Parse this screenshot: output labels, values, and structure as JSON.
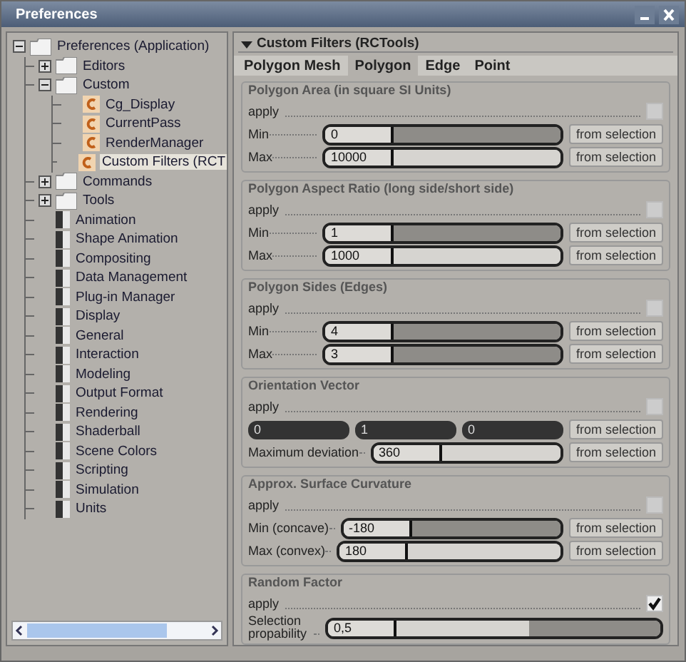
{
  "window": {
    "title": "Preferences"
  },
  "tree": [
    {
      "label": "Preferences (Application)",
      "kind": "folder",
      "expanded": true,
      "selected": false,
      "children": [
        {
          "label": "Editors",
          "kind": "folder",
          "expanded": false,
          "selected": false
        },
        {
          "label": "Custom",
          "kind": "folder",
          "expanded": true,
          "selected": false,
          "children": [
            {
              "label": "Cg_Display",
              "kind": "custom",
              "selected": false
            },
            {
              "label": "CurrentPass",
              "kind": "custom",
              "selected": false
            },
            {
              "label": "RenderManager",
              "kind": "custom",
              "selected": false
            },
            {
              "label": "Custom Filters (RCT",
              "kind": "custom",
              "selected": true
            }
          ]
        },
        {
          "label": "Commands",
          "kind": "folder",
          "expanded": false,
          "selected": false
        },
        {
          "label": "Tools",
          "kind": "folder",
          "expanded": false,
          "selected": false
        },
        {
          "label": "Animation",
          "kind": "pref",
          "selected": false
        },
        {
          "label": "Shape Animation",
          "kind": "pref",
          "selected": false
        },
        {
          "label": "Compositing",
          "kind": "pref",
          "selected": false
        },
        {
          "label": "Data Management",
          "kind": "pref",
          "selected": false
        },
        {
          "label": "Plug-in Manager",
          "kind": "pref",
          "selected": false
        },
        {
          "label": "Display",
          "kind": "pref",
          "selected": false
        },
        {
          "label": "General",
          "kind": "pref",
          "selected": false
        },
        {
          "label": "Interaction",
          "kind": "pref",
          "selected": false
        },
        {
          "label": "Modeling",
          "kind": "pref",
          "selected": false
        },
        {
          "label": "Output Format",
          "kind": "pref",
          "selected": false
        },
        {
          "label": "Rendering",
          "kind": "pref",
          "selected": false
        },
        {
          "label": "Shaderball",
          "kind": "pref",
          "selected": false
        },
        {
          "label": "Scene Colors",
          "kind": "pref",
          "selected": false
        },
        {
          "label": "Scripting",
          "kind": "pref",
          "selected": false
        },
        {
          "label": "Simulation",
          "kind": "pref",
          "selected": false
        },
        {
          "label": "Units",
          "kind": "pref",
          "selected": false
        }
      ]
    }
  ],
  "panel": {
    "title": "Custom Filters (RCTools)",
    "expanded": true,
    "tabs": [
      {
        "label": "Polygon Mesh",
        "selected": false
      },
      {
        "label": "Polygon",
        "selected": true
      },
      {
        "label": "Edge",
        "selected": false
      },
      {
        "label": "Point",
        "selected": false
      }
    ],
    "groups": [
      {
        "title": "Polygon Area (in square SI Units)",
        "rows": [
          {
            "kind": "apply",
            "label": "apply",
            "checked": false
          },
          {
            "kind": "slider",
            "label": "Min",
            "value": "0",
            "level": 0,
            "button": "from selection"
          },
          {
            "kind": "slider",
            "label": "Max",
            "value": "10000",
            "level": 1,
            "button": "from selection"
          }
        ]
      },
      {
        "title": "Polygon Aspect Ratio (long side/short side)",
        "rows": [
          {
            "kind": "apply",
            "label": "apply",
            "checked": false
          },
          {
            "kind": "slider",
            "label": "Min",
            "value": "1",
            "level": 0,
            "button": "from selection"
          },
          {
            "kind": "slider",
            "label": "Max",
            "value": "1000",
            "level": 1,
            "button": "from selection"
          }
        ]
      },
      {
        "title": "Polygon Sides (Edges)",
        "rows": [
          {
            "kind": "apply",
            "label": "apply",
            "checked": false
          },
          {
            "kind": "slider",
            "label": "Min",
            "value": "4",
            "level": 0,
            "button": "from selection"
          },
          {
            "kind": "slider",
            "label": "Max",
            "value": "3",
            "level": 0,
            "button": "from selection"
          }
        ]
      },
      {
        "title": "Orientation Vector",
        "rows": [
          {
            "kind": "apply",
            "label": "apply",
            "checked": false
          },
          {
            "kind": "vector",
            "values": [
              "0",
              "1",
              "0"
            ],
            "button": "from selection"
          },
          {
            "kind": "slider",
            "label": "Maximum deviation",
            "value": "360",
            "level": 1,
            "button": "from selection"
          }
        ]
      },
      {
        "title": "Approx. Surface Curvature",
        "rows": [
          {
            "kind": "apply",
            "label": "apply",
            "checked": false
          },
          {
            "kind": "slider",
            "label": "Min (concave)",
            "value": "-180",
            "level": 0,
            "button": "from selection"
          },
          {
            "kind": "slider",
            "label": "Max (convex)",
            "value": "180",
            "level": 1,
            "button": "from selection"
          }
        ]
      },
      {
        "title": "Random Factor",
        "rows": [
          {
            "kind": "apply",
            "label": "apply",
            "checked": true
          },
          {
            "kind": "slider",
            "label": "Selection propability",
            "value": "0,5",
            "level": 0.5
          }
        ]
      }
    ]
  }
}
